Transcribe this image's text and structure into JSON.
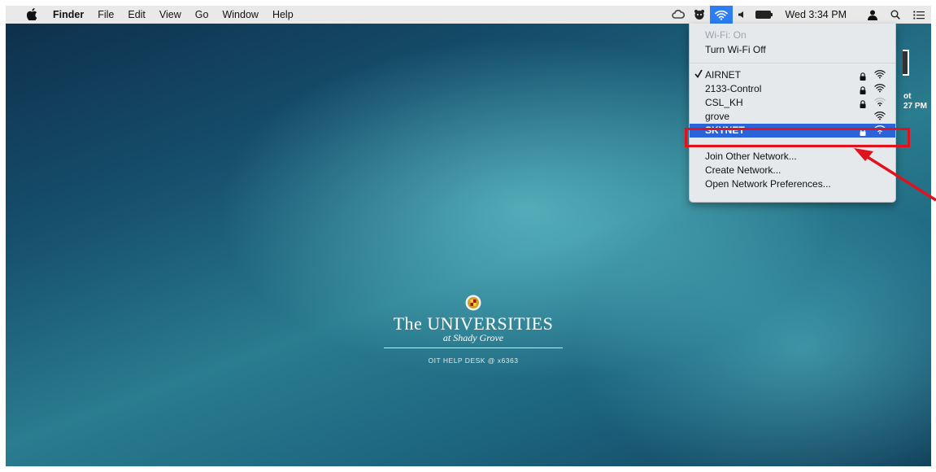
{
  "menubar": {
    "apple_icon": "apple-logo-icon",
    "items": [
      "Finder",
      "File",
      "Edit",
      "View",
      "Go",
      "Window",
      "Help"
    ],
    "status_icons": [
      "creative-cloud-icon",
      "app-status-icon",
      "wifi-icon",
      "volume-icon",
      "battery-icon"
    ],
    "clock": "Wed 3:34 PM",
    "right_icons": [
      "user-icon",
      "spotlight-search-icon",
      "notification-center-icon"
    ]
  },
  "wifi_menu": {
    "status": "Wi-Fi: On",
    "toggle": "Turn Wi-Fi Off",
    "networks": [
      {
        "name": "AIRNET",
        "connected": true,
        "locked": true
      },
      {
        "name": "2133-Control",
        "connected": false,
        "locked": true
      },
      {
        "name": "CSL_KH",
        "connected": false,
        "locked": true
      },
      {
        "name": "grove",
        "connected": false,
        "locked": false
      },
      {
        "name": "SKYNET",
        "connected": false,
        "locked": true,
        "highlighted": true
      }
    ],
    "actions": [
      "Join Other Network...",
      "Create Network...",
      "Open Network Preferences..."
    ]
  },
  "desktop": {
    "frag1": "ot",
    "frag2": "27 PM",
    "logo_title": "The UNIVERSITIES",
    "logo_subtitle": "at Shady Grove",
    "help_desk": "OIT HELP DESK @ x6363"
  },
  "colors": {
    "highlight_box": "#e0131c",
    "selection": "#2b63d9",
    "wifi_active": "#2d7ef2"
  }
}
